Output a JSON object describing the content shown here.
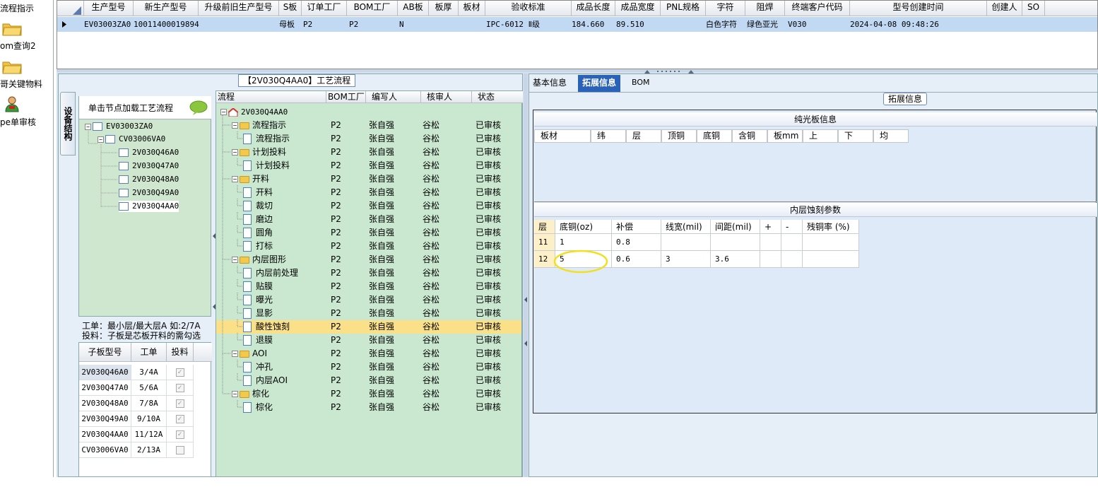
{
  "leftnav": {
    "items": [
      {
        "label": "流程指示",
        "icon": "none"
      },
      {
        "label": "om查询2",
        "icon": "folder-icon"
      },
      {
        "label": "哥关键物料",
        "icon": "folder-icon"
      },
      {
        "label": "pe单审核",
        "icon": "user-icon"
      }
    ]
  },
  "topgrid": {
    "headers": [
      "生产型号",
      "新生产型号",
      "升级前旧生产型号",
      "S板",
      "订单工厂",
      "BOM工厂",
      "AB板",
      "板厚",
      "板材",
      "验收标准",
      "成品长度",
      "成品宽度",
      "PNL规格",
      "字符",
      "阻焊",
      "终端客户代码",
      "型号创建时间",
      "创建人",
      "SO"
    ],
    "row": [
      "EV03003ZA0",
      "10011400019894",
      "",
      "母板",
      "P2",
      "P2",
      "N",
      "",
      "",
      "IPC-6012 Ⅱ级",
      "184.660",
      "89.510",
      "",
      "白色字符",
      "绿色亚光",
      "V030",
      "2024-04-08 09:48:26",
      "",
      ""
    ]
  },
  "leftpanel": {
    "title": "【2V030Q4AA0】工艺流程",
    "vtab_label": "设备结构",
    "hint": "单击节点加载工艺流程",
    "tree": [
      "EV03003ZA0",
      "CV03006VA0",
      "2V030Q46A0",
      "2V030Q47A0",
      "2V030Q48A0",
      "2V030Q49A0",
      "2V030Q4AA0"
    ],
    "note_line1": "工单：最小层/最大层A 如:2/7A",
    "note_line2": "投料：子板是芯板开料的需勾选",
    "sub_headers": [
      "子板型号",
      "工单",
      "投料"
    ],
    "sub_rows": [
      {
        "model": "2V030Q46A0",
        "order": "3/4A",
        "checked": true
      },
      {
        "model": "2V030Q47A0",
        "order": "5/6A",
        "checked": true
      },
      {
        "model": "2V030Q48A0",
        "order": "7/8A",
        "checked": true
      },
      {
        "model": "2V030Q49A0",
        "order": "9/10A",
        "checked": true
      },
      {
        "model": "2V030Q4AA0",
        "order": "11/12A",
        "checked": true
      },
      {
        "model": "CV03006VA0",
        "order": "2/13A",
        "checked": false
      }
    ]
  },
  "process": {
    "headers": [
      "流程",
      "BOM工厂",
      "编写人",
      "核审人",
      "状态"
    ],
    "root": "2V030Q4AA0",
    "rows": [
      {
        "name": "流程指示",
        "type": "folder",
        "bom": "P2",
        "writer": "张自强",
        "reviewer": "谷松",
        "status": "已审核"
      },
      {
        "name": "流程指示",
        "type": "doc",
        "bom": "P2",
        "writer": "张自强",
        "reviewer": "谷松",
        "status": "已审核"
      },
      {
        "name": "计划投料",
        "type": "folder",
        "bom": "P2",
        "writer": "张自强",
        "reviewer": "谷松",
        "status": "已审核"
      },
      {
        "name": "计划投料",
        "type": "doc",
        "bom": "P2",
        "writer": "张自强",
        "reviewer": "谷松",
        "status": "已审核"
      },
      {
        "name": "开料",
        "type": "folder",
        "bom": "P2",
        "writer": "张自强",
        "reviewer": "谷松",
        "status": "已审核"
      },
      {
        "name": "开料",
        "type": "doc",
        "bom": "P2",
        "writer": "张自强",
        "reviewer": "谷松",
        "status": "已审核"
      },
      {
        "name": "裁切",
        "type": "doc",
        "bom": "P2",
        "writer": "张自强",
        "reviewer": "谷松",
        "status": "已审核"
      },
      {
        "name": "磨边",
        "type": "doc",
        "bom": "P2",
        "writer": "张自强",
        "reviewer": "谷松",
        "status": "已审核"
      },
      {
        "name": "圆角",
        "type": "doc",
        "bom": "P2",
        "writer": "张自强",
        "reviewer": "谷松",
        "status": "已审核"
      },
      {
        "name": "打标",
        "type": "doc",
        "bom": "P2",
        "writer": "张自强",
        "reviewer": "谷松",
        "status": "已审核"
      },
      {
        "name": "内层图形",
        "type": "folder",
        "bom": "P2",
        "writer": "张自强",
        "reviewer": "谷松",
        "status": "已审核"
      },
      {
        "name": "内层前处理",
        "type": "doc",
        "bom": "P2",
        "writer": "张自强",
        "reviewer": "谷松",
        "status": "已审核"
      },
      {
        "name": "贴膜",
        "type": "doc",
        "bom": "P2",
        "writer": "张自强",
        "reviewer": "谷松",
        "status": "已审核"
      },
      {
        "name": "曝光",
        "type": "doc",
        "bom": "P2",
        "writer": "张自强",
        "reviewer": "谷松",
        "status": "已审核"
      },
      {
        "name": "显影",
        "type": "doc",
        "bom": "P2",
        "writer": "张自强",
        "reviewer": "谷松",
        "status": "已审核"
      },
      {
        "name": "酸性蚀刻",
        "type": "doc",
        "bom": "P2",
        "writer": "张自强",
        "reviewer": "谷松",
        "status": "已审核",
        "selected": true
      },
      {
        "name": "退膜",
        "type": "doc",
        "bom": "P2",
        "writer": "张自强",
        "reviewer": "谷松",
        "status": "已审核"
      },
      {
        "name": "AOI",
        "type": "folder",
        "bom": "P2",
        "writer": "张自强",
        "reviewer": "谷松",
        "status": "已审核"
      },
      {
        "name": "冲孔",
        "type": "doc",
        "bom": "P2",
        "writer": "张自强",
        "reviewer": "谷松",
        "status": "已审核"
      },
      {
        "name": "内层AOI",
        "type": "doc",
        "bom": "P2",
        "writer": "张自强",
        "reviewer": "谷松",
        "status": "已审核"
      },
      {
        "name": "棕化",
        "type": "folder",
        "bom": "P2",
        "writer": "张自强",
        "reviewer": "谷松",
        "status": "已审核"
      },
      {
        "name": "棕化",
        "type": "doc",
        "bom": "P2",
        "writer": "张自强",
        "reviewer": "谷松",
        "status": "已审核"
      }
    ]
  },
  "rightpanel": {
    "tabs": [
      "基本信息",
      "拓展信息",
      "BOM"
    ],
    "group_title": "拓展信息",
    "section1_title": "纯光板信息",
    "section1_headers": [
      "板材",
      "纬",
      "层",
      "顶铜",
      "底铜",
      "含铜",
      "板mm",
      "上",
      "下",
      "均"
    ],
    "section2_title": "内层蚀刻参数",
    "section2_headers": [
      "层",
      "底铜(oz)",
      "补偿",
      "线宽(mil)",
      "间距(mil)",
      "+",
      "-",
      "残铜率 (%)"
    ],
    "section2_rows": [
      [
        "11",
        "1",
        "0.8",
        "",
        "",
        "",
        "",
        ""
      ],
      [
        "12",
        "5",
        "0.6",
        "3",
        "3.6",
        "",
        "",
        ""
      ]
    ]
  },
  "colors": {
    "selected_row": "#c2d9f4",
    "tree_bg": "#c9e8cf",
    "highlight_row": "#fbe08a",
    "active_tab": "#2a62b8",
    "annotation_circle": "#f0e020"
  }
}
